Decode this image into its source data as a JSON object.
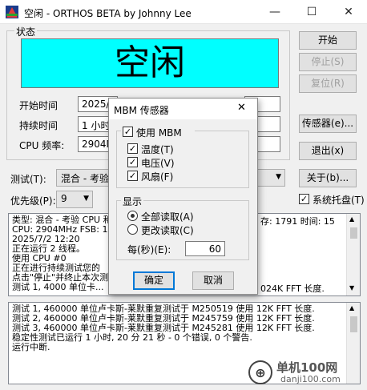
{
  "window": {
    "title": "空闲 - ORTHOS BETA by Johnny Lee",
    "minimize": "—",
    "maximize": "☐",
    "close": "✕"
  },
  "status": {
    "group_label": "状态",
    "big_text": "空闲"
  },
  "info": {
    "start_time_label": "开始时间",
    "start_time_value": "2025/7/",
    "duration_label": "持续时间",
    "duration_value": "1 小时",
    "cpu_freq_label": "CPU 频率:",
    "cpu_freq_value": "2904MH"
  },
  "right_buttons": {
    "start": "开始",
    "stop": "停止(S)",
    "reset": "复位(R)",
    "sensor": "传感器(e)...",
    "exit": "退出(x)",
    "about": "关于(b)..."
  },
  "test": {
    "label": "测试(T):",
    "value": "混合 - 考验"
  },
  "priority": {
    "label": "优先级(P):",
    "value": "9"
  },
  "systray": {
    "label": "系统托盘(T)",
    "checked": true
  },
  "log_top": [
    "类型: 混合 - 考验 CPU 和",
    "CPU: 2904MHz FSB: 100M",
    "2025/7/2 12:20",
    "正在运行 2 线程。",
    "使用 CPU #0",
    "正在进行持续测试您的",
    "点击\"停止\"并终止本次测",
    "测试 1, 4000 单位卡..."
  ],
  "log_top_right": {
    "mem": "存: 1791 时间: 15",
    "fft": "024K FFT 长度."
  },
  "log_bottom": [
    "测试 1, 460000 单位卢卡斯-莱默重复测试于 M250519 使用 12K FFT 长度.",
    "测试 2, 460000 单位卢卡斯-莱默重复测试于 M245759 使用 12K FFT 长度.",
    "测试 3, 460000 单位卢卡斯-莱默重复测试于 M245281 使用 12K FFT 长度.",
    "稳定性测试已运行 1 小时, 20 分 21 秒 - 0 个错误, 0 个警告.",
    "运行中断."
  ],
  "dialog": {
    "title": "MBM 传感器",
    "close": "✕",
    "use_mbm": "使用 MBM",
    "temp": "温度(T)",
    "voltage": "电压(V)",
    "fan": "风扇(F)",
    "display_label": "显示",
    "read_all": "全部读取(A)",
    "read_changed": "更改读取(C)",
    "interval_label": "每(秒)(E):",
    "interval_value": "60",
    "ok": "确定",
    "cancel": "取消"
  },
  "watermark": {
    "site": "单机100网",
    "url": "danji100.com"
  },
  "colors": {
    "status_bg": "#00ffff",
    "dialog_focus": "#0078d7"
  }
}
